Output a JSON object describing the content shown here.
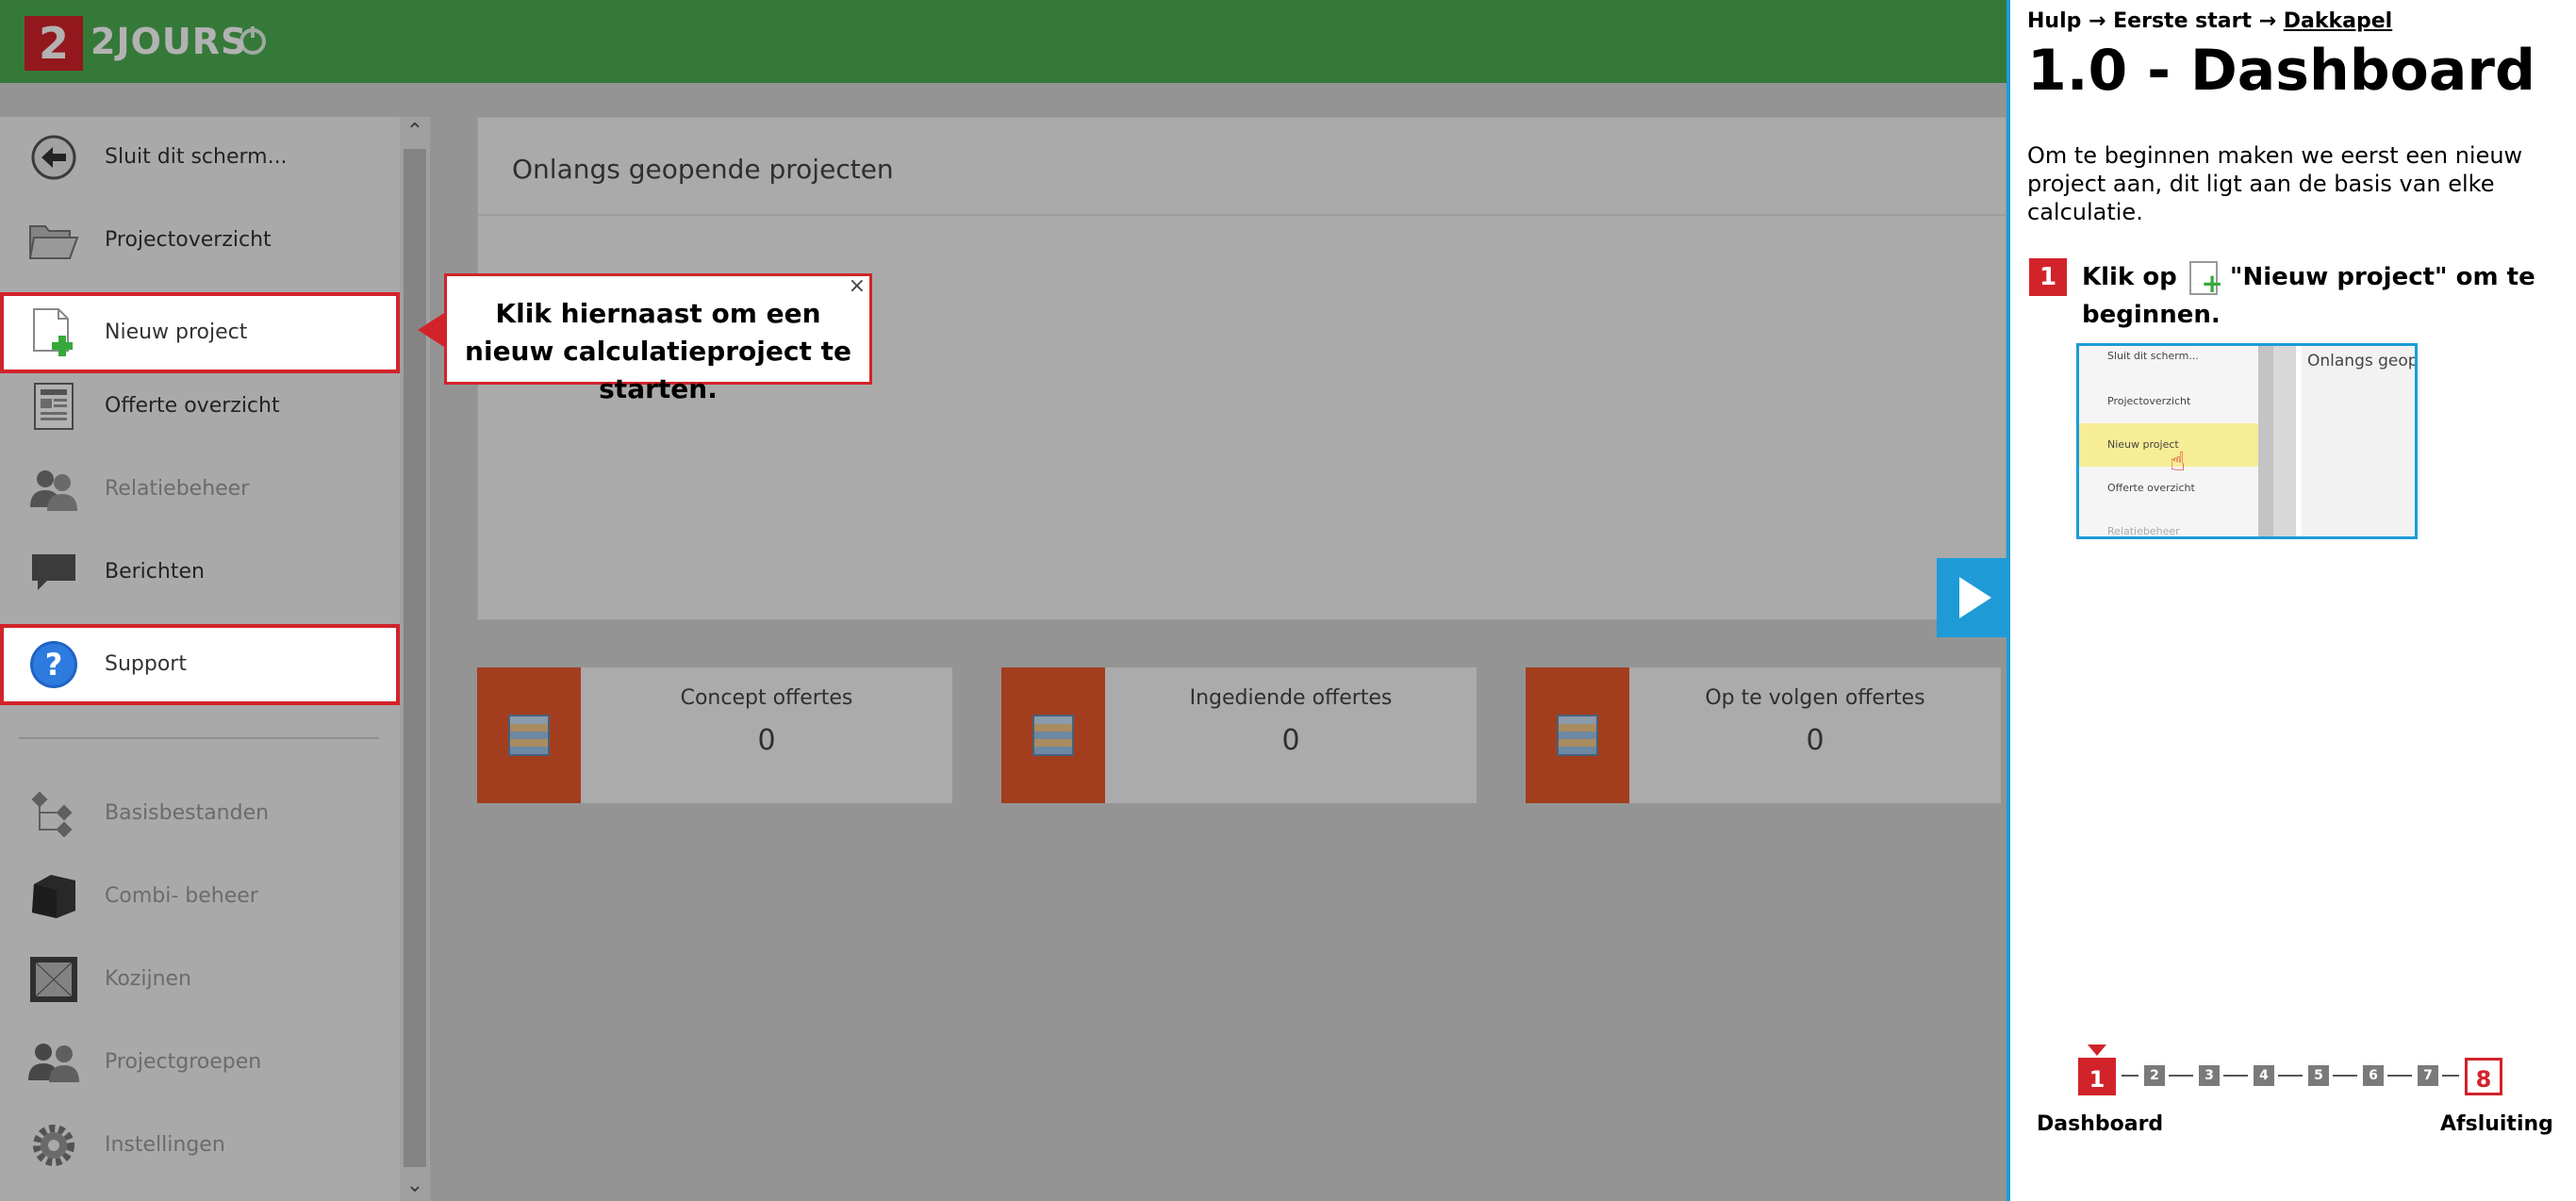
{
  "app": {
    "brand": "2JOURS",
    "logo_glyph": "2"
  },
  "sidebar": {
    "items": [
      {
        "label": "Sluit dit scherm...",
        "icon": "back-arrow-icon",
        "enabled": true,
        "highlighted": false
      },
      {
        "label": "Projectoverzicht",
        "icon": "folder-icon",
        "enabled": true,
        "highlighted": false
      },
      {
        "label": "Nieuw project",
        "icon": "new-document-icon",
        "enabled": true,
        "highlighted": true
      },
      {
        "label": "Offerte overzicht",
        "icon": "offer-document-icon",
        "enabled": true,
        "highlighted": false
      },
      {
        "label": "Relatiebeheer",
        "icon": "people-icon",
        "enabled": false,
        "highlighted": false
      },
      {
        "label": "Berichten",
        "icon": "message-bubble-icon",
        "enabled": true,
        "highlighted": false
      },
      {
        "label": "Support",
        "icon": "help-question-icon",
        "enabled": true,
        "highlighted": true
      },
      {
        "label": "Basisbestanden",
        "icon": "tree-structure-icon",
        "enabled": false,
        "highlighted": false
      },
      {
        "label": "Combi- beheer",
        "icon": "cube-icon",
        "enabled": false,
        "highlighted": false
      },
      {
        "label": "Kozijnen",
        "icon": "window-frame-icon",
        "enabled": false,
        "highlighted": false
      },
      {
        "label": "Projectgroepen",
        "icon": "group-icon",
        "enabled": false,
        "highlighted": false
      },
      {
        "label": "Instellingen",
        "icon": "gear-icon",
        "enabled": false,
        "highlighted": false
      }
    ]
  },
  "main": {
    "panel_title": "Onlangs geopende projecten",
    "stats": [
      {
        "title": "Concept offertes",
        "value": "0"
      },
      {
        "title": "Ingediende offertes",
        "value": "0"
      },
      {
        "title": "Op te volgen offertes",
        "value": "0"
      }
    ]
  },
  "callout": {
    "text": "Klik hiernaast om een nieuw calculatieproject te starten.",
    "close": "×"
  },
  "help": {
    "breadcrumb": {
      "part1": "Hulp",
      "sep": "→",
      "part2": "Eerste start",
      "current": "Dakkapel"
    },
    "title": "1.0 - Dashboard",
    "intro": "Om te beginnen maken we eerst een nieuw project aan, dit ligt aan de basis van elke calculatie.",
    "step": {
      "number": "1",
      "text_before": "Klik op",
      "text_after": "\"Nieuw project\" om te beginnen."
    },
    "thumbnail": {
      "items": [
        "Sluit dit scherm...",
        "Projectoverzicht",
        "Nieuw project",
        "Offerte overzicht",
        "Relatiebeheer"
      ],
      "panel_title": "Onlangs geop"
    },
    "progress": {
      "steps": [
        "1",
        "2",
        "3",
        "4",
        "5",
        "6",
        "7",
        "8"
      ],
      "current": 1,
      "start_label": "Dashboard",
      "end_label": "Afsluiting"
    }
  },
  "colors": {
    "brand_green": "#4cae52",
    "accent_red": "#d2232a",
    "help_blue": "#1e9bd7",
    "tile_orange": "#e8592a"
  }
}
